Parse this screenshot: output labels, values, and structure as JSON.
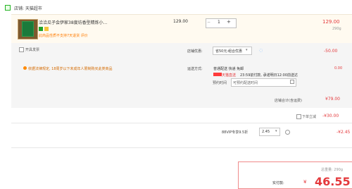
{
  "shop": {
    "name": "店铺: 天猫超市"
  },
  "item": {
    "title": "洽洽瓜子会伊家38度坊香型精炼小...",
    "notice": "此商品性质不支持7天退货 评价",
    "unit_price": "129.00",
    "quantity": "1",
    "qty_minus": "−",
    "qty_plus": "+",
    "subtotal": "129.00",
    "weight": "290g"
  },
  "promo": {
    "checkbox_label": "开具发票",
    "label": "店铺优惠:",
    "selected": "省50元:组合优惠",
    "discount": "-50.00"
  },
  "delivery": {
    "location_notice": "依据法律规定, 18周岁以下未成年人限制购买此类商品",
    "label": "运送方式:",
    "method": "普通配送 快递 免邮",
    "fee": "0.00",
    "tmall_badge": "天猫直送",
    "cutoff_note": "23:59前付款, 承诺明日12:00前送达",
    "appointment_label": "预约时间",
    "appointment_placeholder": "可预约配送时间"
  },
  "shop_total": {
    "label": "店铺合计(含运费)",
    "value": "¥79.00"
  },
  "order_discount": {
    "label": "下单立减",
    "value": "-¥30.00"
  },
  "vip": {
    "label": "88VIP专享9.5折",
    "selected": "2.45",
    "discount": "-¥2.45"
  },
  "summary": {
    "weight": "总重量: 290g",
    "label": "实付款:",
    "currency": "¥",
    "price": "46.55"
  },
  "colors": {
    "accent": "#e4393c",
    "tmall_green": "#22a32a",
    "warning_orange": "#ff7b00"
  },
  "icons": {
    "shop": "check-square-icon",
    "location": "location-pin-icon",
    "calendar": "calendar-icon",
    "info": "info-icon",
    "chat": "chat-icon"
  }
}
